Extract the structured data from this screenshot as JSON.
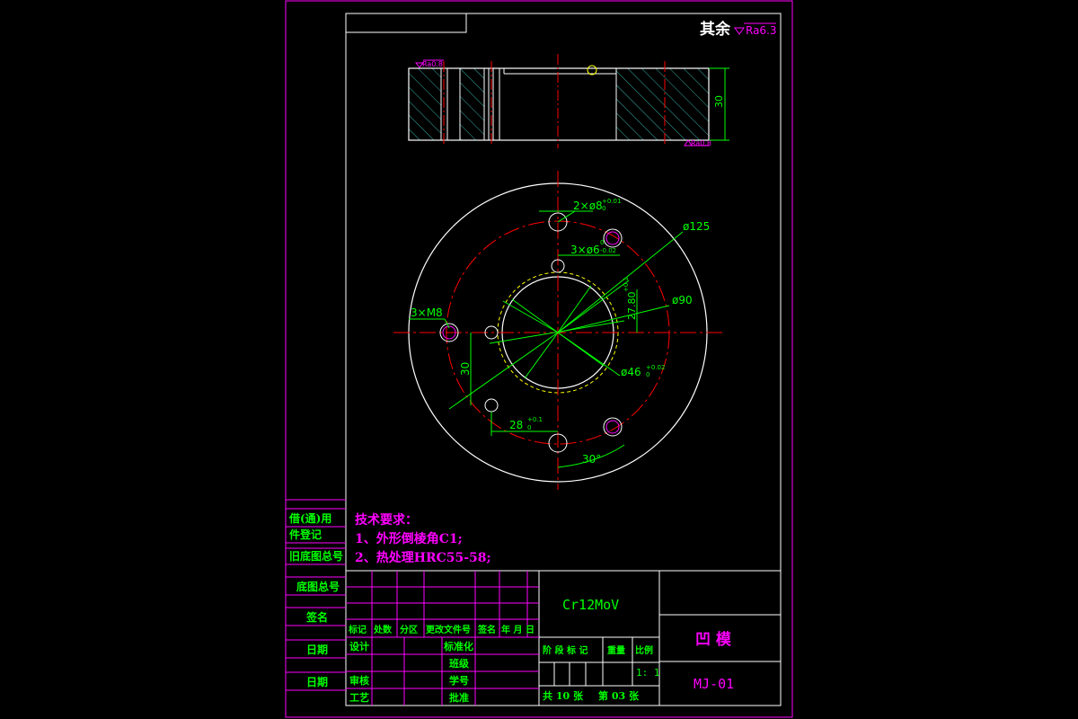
{
  "colors": {
    "background": "#000000",
    "frame": "#ff00ff",
    "outline": "#ffffff",
    "dimension": "#00ff00",
    "centerline": "#ff0000",
    "hidden": "#ffff00",
    "title_text": "#00ff00",
    "note_text": "#ff00ff"
  },
  "roughness": {
    "general_label": "其余",
    "general_value": "Ra6.3",
    "face_value_1": "Ra0.8",
    "face_value_2": "Ra0.8"
  },
  "section_view": {
    "thickness_dim": "30"
  },
  "plan_view": {
    "dim_pins": "2×ø8",
    "dim_pins_tol": "+0.01",
    "dim_pins_tol_low": "0",
    "dim_small_holes": "3×ø6",
    "dim_small_holes_tol_up": "0",
    "dim_small_holes_tol": "-0.02",
    "dim_outer": "ø125",
    "dim_bolt_circle": "ø90",
    "dim_radius": "27.80",
    "dim_radius_tol": "+0.1",
    "dim_threads": "3×M8",
    "dim_height": "30",
    "dim_bore": "ø46",
    "dim_bore_tol": "+0.02",
    "dim_bore_tol_low": "0",
    "dim_offset": "28",
    "dim_offset_tol": "+0.1",
    "dim_offset_tol_low": "0",
    "dim_angle": "30°"
  },
  "tech_requirements": {
    "heading": "技术要求：",
    "item1": "1、外形倒棱角C1;",
    "item2": "2、热处理HRC55-58;"
  },
  "side_table": {
    "r1": "借(通)用",
    "r2": "件登记",
    "r3": "旧底图总号",
    "r4": "底图总号",
    "r5": "签名",
    "r6": "日期",
    "r7": "日期"
  },
  "title_block": {
    "material": "Cr12MoV",
    "part_name": "凹  模",
    "drawing_no": "MJ-01",
    "h_mark": "标记",
    "h_count": "处数",
    "h_zone": "分区",
    "h_docno": "更改文件号",
    "h_sign": "签名",
    "h_date": "年 月 日",
    "design": "设计",
    "standardize": "标准化",
    "check": "审核",
    "process": "工艺",
    "review": "班级",
    "student_no": "学号",
    "approve": "批准",
    "stage_label": "阶 段 标 记",
    "weight_label": "重量",
    "scale_label": "比例",
    "scale_value": "1: 1",
    "sheets_total": "共 10 张",
    "sheet_no": "第 03 张"
  }
}
